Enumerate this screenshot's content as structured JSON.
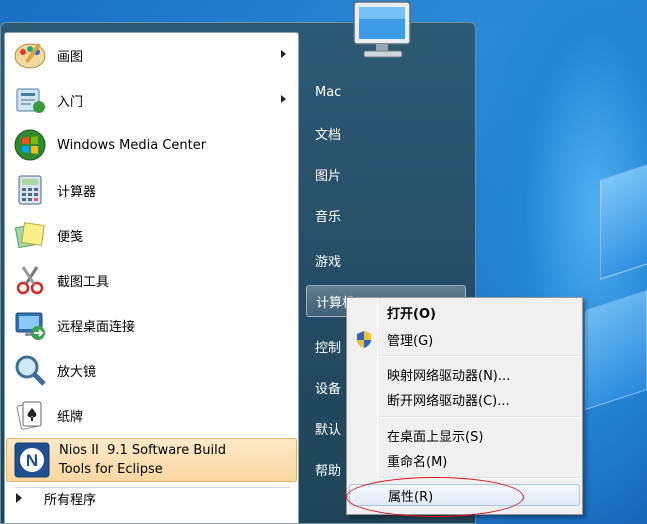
{
  "left_menu": {
    "items": [
      {
        "label": "画图",
        "icon": "paint-icon",
        "has_arrow": true
      },
      {
        "label": "入门",
        "icon": "getting-started-icon",
        "has_arrow": true
      },
      {
        "label": "Windows Media Center",
        "icon": "media-center-icon",
        "has_arrow": false
      },
      {
        "label": "计算器",
        "icon": "calculator-icon",
        "has_arrow": false
      },
      {
        "label": "便笺",
        "icon": "sticky-notes-icon",
        "has_arrow": false
      },
      {
        "label": "截图工具",
        "icon": "snipping-tool-icon",
        "has_arrow": false
      },
      {
        "label": "远程桌面连接",
        "icon": "remote-desktop-icon",
        "has_arrow": false
      },
      {
        "label": "放大镜",
        "icon": "magnifier-icon",
        "has_arrow": false
      },
      {
        "label": "纸牌",
        "icon": "solitaire-icon",
        "has_arrow": false
      }
    ],
    "pinned_highlight": {
      "line1": "Nios II  9.1 Software Build",
      "line2": "Tools for Eclipse",
      "icon": "nios-icon"
    },
    "all_programs": "所有程序"
  },
  "right_menu": {
    "items": [
      "Mac",
      "文档",
      "图片",
      "音乐",
      "游戏",
      "计算机",
      "控制",
      "设备",
      "默认",
      "帮助"
    ]
  },
  "context_menu": {
    "items": [
      {
        "label": "打开(O)",
        "bold": true
      },
      {
        "label": "管理(G)",
        "icon": "uac-shield-icon"
      },
      {
        "label": "映射网络驱动器(N)..."
      },
      {
        "label": "断开网络驱动器(C)..."
      },
      {
        "label": "在桌面上显示(S)"
      },
      {
        "label": "重命名(M)"
      },
      {
        "label": "属性(R)",
        "selected": true
      }
    ]
  },
  "colors": {
    "highlight_border": "#e7b56b",
    "annotation_circle": "#d8141c",
    "start_menu_right": "#264d66"
  }
}
